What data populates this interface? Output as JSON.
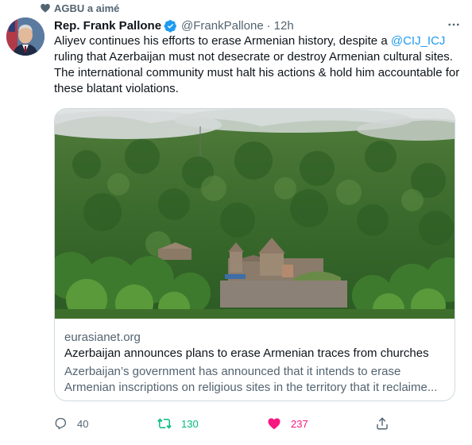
{
  "social_context": {
    "text": "AGBU a aimé",
    "icon": "heart-icon"
  },
  "author": {
    "name": "Rep. Frank Pallone",
    "verified_icon": "verified-badge-icon",
    "handle": "@FrankPallone",
    "separator": "·",
    "time": "12h"
  },
  "more_icon": "more-options-icon",
  "tweet": {
    "part1": "Aliyev continues his efforts to erase Armenian history, despite a ",
    "mention": "@CIJ_ICJ",
    "part2": " ruling that Azerbaijan must not desecrate or destroy Armenian cultural sites. The international community must halt his actions & hold him accountable for these blatant violations."
  },
  "card": {
    "domain": "eurasianet.org",
    "title": "Azerbaijan announces plans to erase Armenian traces from churches",
    "description_line1": "Azerbaijan’s government has announced that it intends to erase",
    "description_line2": "Armenian inscriptions on religious sites in the territory that it reclaime..."
  },
  "actions": {
    "reply_count": "40",
    "retweet_count": "130",
    "like_count": "237"
  },
  "colors": {
    "accent": "#1d9bf0",
    "retweet": "#00ba7c",
    "like": "#f91880",
    "muted": "#536471"
  }
}
